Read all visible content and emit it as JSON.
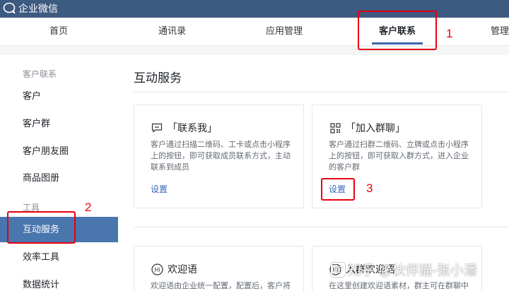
{
  "app": {
    "title": "企业微信"
  },
  "nav": {
    "items": [
      {
        "label": "首页"
      },
      {
        "label": "通讯录"
      },
      {
        "label": "应用管理"
      },
      {
        "label": "客户联系"
      },
      {
        "label": "管理"
      }
    ]
  },
  "sidebar": {
    "group1": "客户联系",
    "items1": [
      "客户",
      "客户群",
      "客户朋友圈",
      "商品图册"
    ],
    "group2": "工具",
    "items2": [
      "互动服务",
      "效率工具",
      "数据统计"
    ]
  },
  "main": {
    "title": "互动服务",
    "cards": [
      {
        "title": "「联系我」",
        "desc": "客户通过扫描二维码、工卡或点击小程序上的按钮，即可获取成员联系方式，主动联系到成员",
        "link": "设置"
      },
      {
        "title": "「加入群聊」",
        "desc": "客户通过扫群二维码、立牌或点击小程序上的按钮，即可获取入群方式，进入企业的客户群",
        "link": "设置"
      },
      {
        "title": "欢迎语",
        "desc": "欢迎语由企业统一配置，配置后，客户将"
      },
      {
        "title": "入群欢迎语",
        "desc": "在这里创建欢迎语素材，群主可在群聊中"
      }
    ]
  },
  "annotations": {
    "n1": "1",
    "n2": "2",
    "n3": "3"
  },
  "watermark": {
    "text": "知乎 @伙伴猫-张小潘"
  },
  "colors": {
    "topbar": "#3d5a80",
    "active": "#4a76ae",
    "link": "#3a66b5",
    "annotation": "#e60012"
  }
}
